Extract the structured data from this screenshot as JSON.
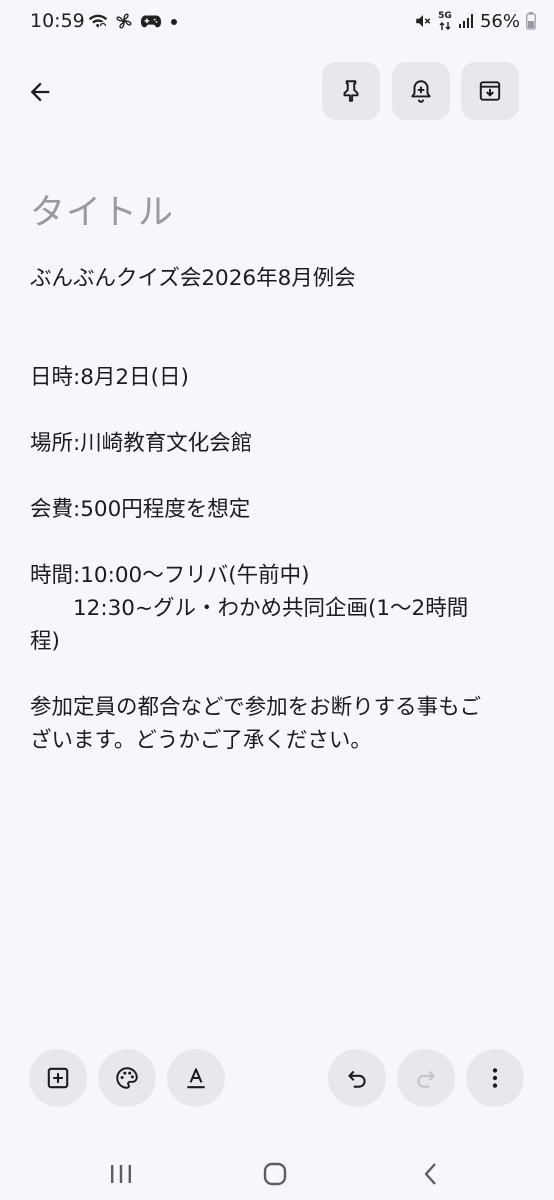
{
  "status_bar": {
    "time": "10:59",
    "network_label": "5G",
    "battery": "56%",
    "left_icons": [
      "wifi-icon",
      "fan-icon",
      "gamepad-icon",
      "dot-icon"
    ],
    "right_icons": [
      "mute-icon",
      "data-arrows-icon",
      "signal-icon",
      "battery-icon"
    ]
  },
  "toolbar": {
    "back_icon": "arrow-left-icon",
    "pin_icon": "pin-icon",
    "reminder_icon": "bell-plus-icon",
    "archive_icon": "archive-icon"
  },
  "note": {
    "title_placeholder": "タイトル",
    "lines": [
      "ぶんぶんクイズ会2026年8月例会",
      "",
      "",
      "日時:8月2日(日)",
      "",
      "場所:川崎教育文化会館",
      "",
      "会費:500円程度を想定",
      "",
      "時間:10:00〜フリバ(午前中)",
      "　　12:30~グル・わかめ共同企画(1〜2時間",
      "程)",
      "",
      "参加定員の都合などで参加をお断りする事もご",
      "ざいます。どうかご了承ください。"
    ]
  },
  "bottom_toolbar": {
    "add_icon": "add-box-icon",
    "palette_icon": "palette-icon",
    "format_icon": "text-format-icon",
    "undo_icon": "undo-icon",
    "redo_icon": "redo-icon",
    "more_icon": "more-vert-icon"
  },
  "nav_bar": {
    "recents_icon": "recents-icon",
    "home_icon": "home-icon",
    "back_icon": "nav-back-icon"
  },
  "colors": {
    "background": "#f8f6fb",
    "button_bg": "#e9e6ee",
    "text": "#1c1b1f",
    "placeholder": "#9a98a0",
    "disabled": "#c4c2c8"
  }
}
